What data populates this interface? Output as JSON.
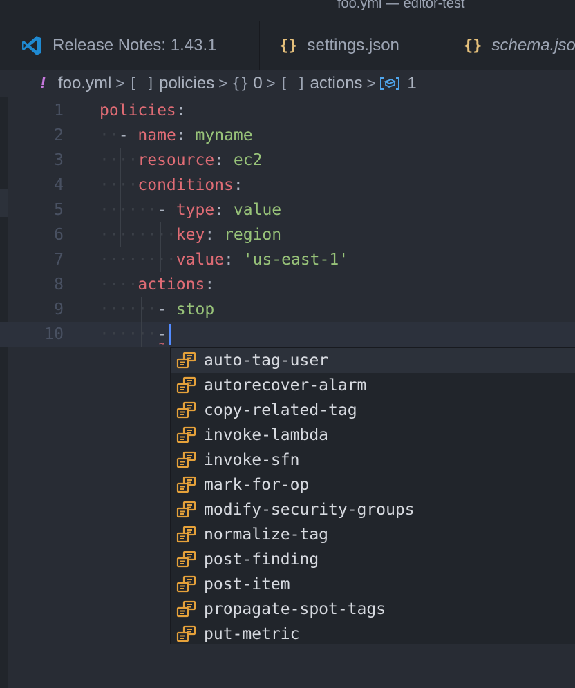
{
  "window": {
    "title": "foo.yml — editor-test"
  },
  "tabs": [
    {
      "label": "Release Notes: 1.43.1",
      "icon": "vscode-logo-icon"
    },
    {
      "label": "settings.json",
      "icon": "json-braces-icon",
      "glyph": "{}"
    },
    {
      "label": "schema.json",
      "icon": "json-braces-icon",
      "glyph": "{}"
    }
  ],
  "breadcrumb": {
    "file": "foo.yml",
    "bang": "!",
    "sep": ">",
    "items": [
      {
        "sym": "[ ]",
        "label": "policies"
      },
      {
        "sym": "{}",
        "label": "0"
      },
      {
        "sym": "[ ]",
        "label": "actions"
      },
      {
        "label": "1"
      }
    ]
  },
  "editor": {
    "lines": [
      {
        "n": "1"
      },
      {
        "n": "2"
      },
      {
        "n": "3"
      },
      {
        "n": "4"
      },
      {
        "n": "5"
      },
      {
        "n": "6"
      },
      {
        "n": "7"
      },
      {
        "n": "8"
      },
      {
        "n": "9"
      },
      {
        "n": "10"
      }
    ],
    "tokens": {
      "policies": "policies",
      "colon": ":",
      "dash": "-",
      "name": "name",
      "myname": "myname",
      "resource": "resource",
      "ec2": "ec2",
      "conditions": "conditions",
      "type": "type",
      "value_word": "value",
      "key": "key",
      "region": "region",
      "value_key": "value",
      "us_east": "'us-east-1'",
      "actions": "actions",
      "stop": "stop"
    }
  },
  "suggestions": [
    "auto-tag-user",
    "autorecover-alarm",
    "copy-related-tag",
    "invoke-lambda",
    "invoke-sfn",
    "mark-for-op",
    "modify-security-groups",
    "normalize-tag",
    "post-finding",
    "post-item",
    "propagate-spot-tags",
    "put-metric"
  ],
  "colors": {
    "keyword": "#e06c75",
    "string": "#98c379",
    "accent": "#528bff",
    "icon": "#e5a13a"
  }
}
